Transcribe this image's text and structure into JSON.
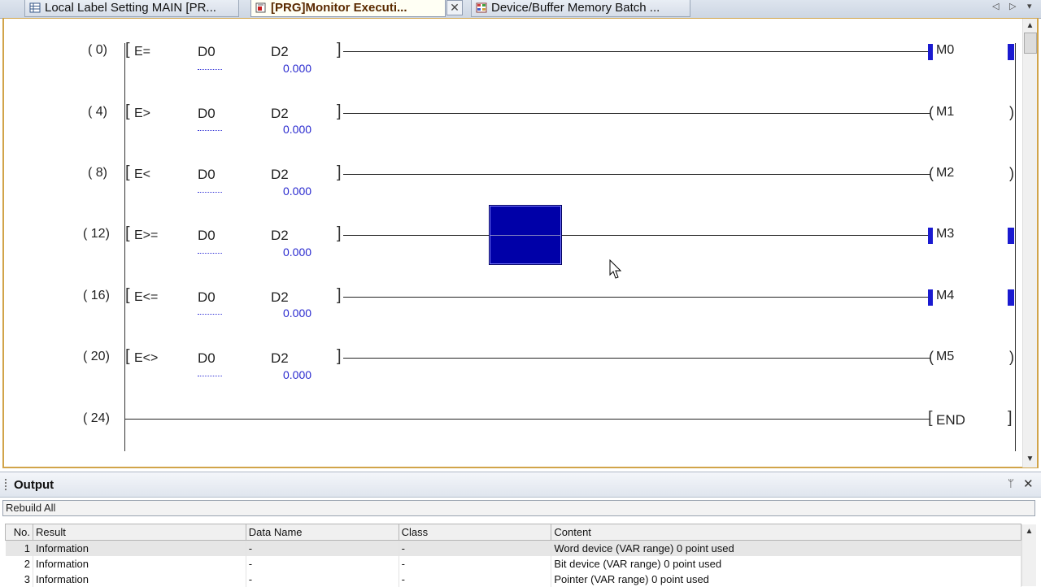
{
  "tabs": [
    {
      "label": "Local Label Setting MAIN [PR...",
      "icon": "label-table-icon",
      "active": false
    },
    {
      "label": "[PRG]Monitor Executi...",
      "icon": "program-icon",
      "active": true
    },
    {
      "label": "Device/Buffer Memory Batch ...",
      "icon": "memory-grid-icon",
      "active": false
    }
  ],
  "tab_close_glyph": "✕",
  "tab_nav": {
    "left": "◁",
    "right": "▷",
    "menu": "▾"
  },
  "ladder": {
    "rungs": [
      {
        "step": "(    0)",
        "instruction": "E=",
        "src1": "D0",
        "src2": "D2",
        "value2": "0.000",
        "coil": "M0",
        "coil_on": true
      },
      {
        "step": "(    4)",
        "instruction": "E>",
        "src1": "D0",
        "src2": "D2",
        "value2": "0.000",
        "coil": "M1",
        "coil_on": false
      },
      {
        "step": "(    8)",
        "instruction": "E<",
        "src1": "D0",
        "src2": "D2",
        "value2": "0.000",
        "coil": "M2",
        "coil_on": false
      },
      {
        "step": "(  12)",
        "instruction": "E>=",
        "src1": "D0",
        "src2": "D2",
        "value2": "0.000",
        "coil": "M3",
        "coil_on": true
      },
      {
        "step": "(  16)",
        "instruction": "E<=",
        "src1": "D0",
        "src2": "D2",
        "value2": "0.000",
        "coil": "M4",
        "coil_on": true
      },
      {
        "step": "(  20)",
        "instruction": "E<>",
        "src1": "D0",
        "src2": "D2",
        "value2": "0.000",
        "coil": "M5",
        "coil_on": false
      }
    ],
    "end_step": "(  24)",
    "end_label": "END"
  },
  "output": {
    "title": "Output",
    "pin_glyph": "ᛘ",
    "close_glyph": "✕",
    "mode": "Rebuild All",
    "columns": [
      "No.",
      "Result",
      "Data Name",
      "Class",
      "Content"
    ],
    "rows": [
      {
        "no": "1",
        "result": "Information",
        "data_name": "-",
        "class": "-",
        "content": "Word device (VAR range) 0 point used"
      },
      {
        "no": "2",
        "result": "Information",
        "data_name": "-",
        "class": "-",
        "content": "Bit device (VAR range) 0 point used"
      },
      {
        "no": "3",
        "result": "Information",
        "data_name": "-",
        "class": "-",
        "content": "Pointer (VAR range) 0 point used"
      }
    ]
  },
  "scroll": {
    "up": "▲",
    "down": "▼"
  },
  "colors": {
    "monitor_on": "#1a1ad0",
    "monitor_value": "#2a2acf",
    "cursor": "#0000a8",
    "active_tab_text": "#5a2a00"
  }
}
